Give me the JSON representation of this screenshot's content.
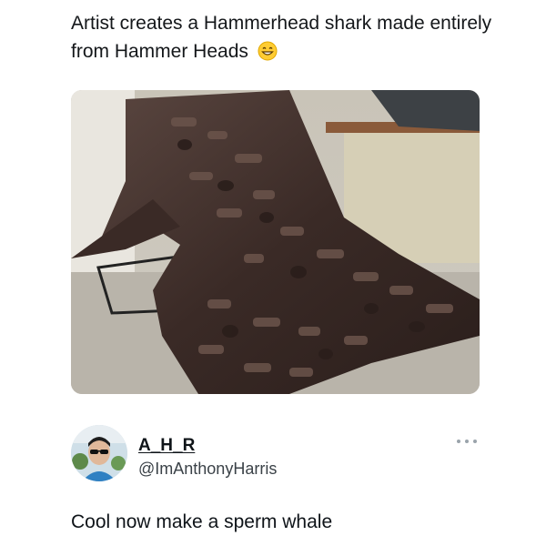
{
  "post": {
    "text": "Artist creates a Hammerhead shark made entirely from Hammer Heads",
    "emoji_icon": "grinning-face-emoji",
    "photo_icon": "hammer-shark-sculpture-photo"
  },
  "reply": {
    "name": "A_H_R",
    "handle": "@ImAnthonyHarris",
    "text": "Cool now make a sperm whale",
    "avatar_icon": "user-avatar-sunglasses",
    "more_icon": "more-options-icon"
  }
}
